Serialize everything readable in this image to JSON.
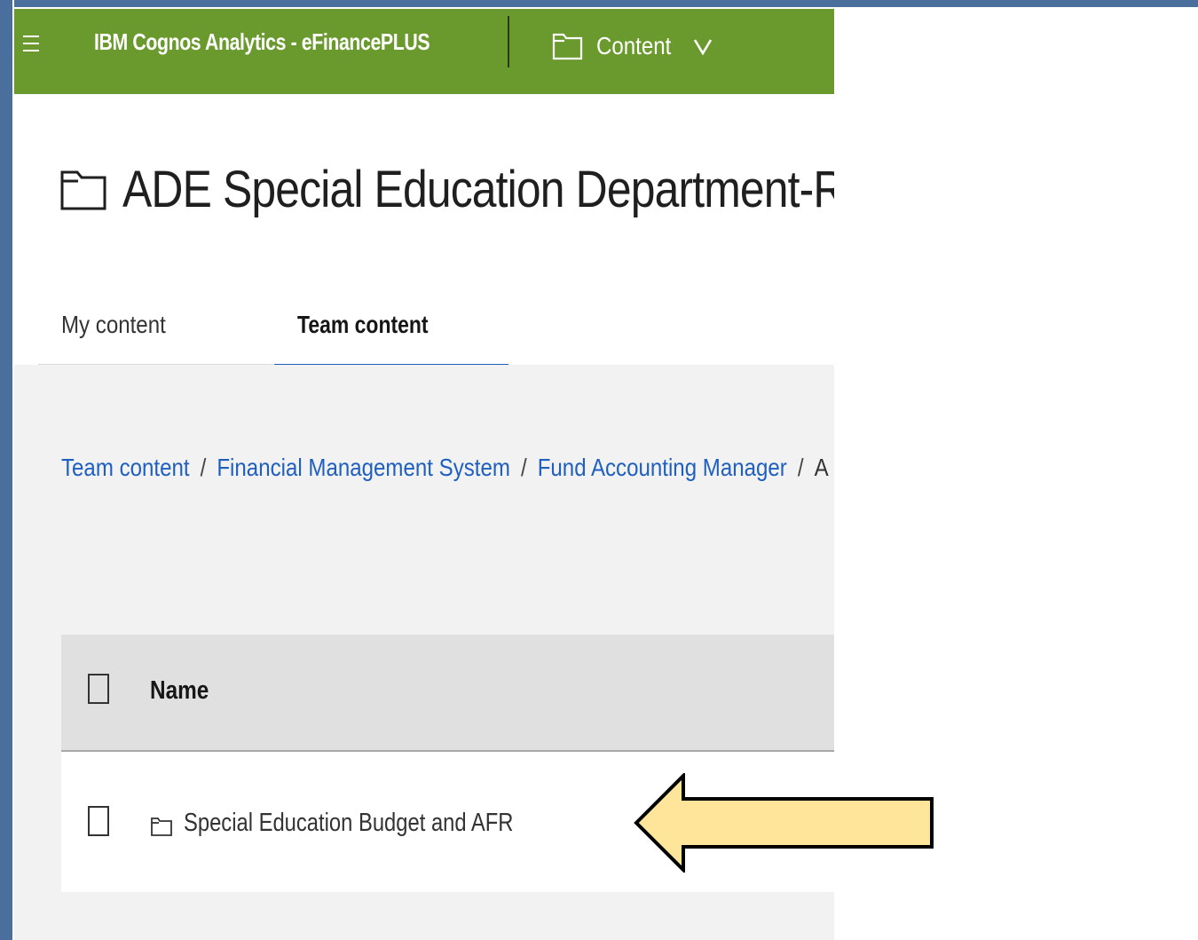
{
  "topbar": {
    "menu_icon": "hamburger-menu-icon",
    "title": "IBM Cognos Analytics - eFinancePLUS",
    "content_label": "Content",
    "content_icon": "folder-icon",
    "dropdown_icon": "chevron-down-icon",
    "background_color": "#6a9a2e"
  },
  "page": {
    "title": "ADE Special Education Department-Re",
    "title_icon": "folder-icon"
  },
  "tabs": [
    {
      "label": "My content",
      "active": false
    },
    {
      "label": "Team content",
      "active": true
    }
  ],
  "breadcrumb": {
    "items": [
      "Team content",
      "Financial Management System",
      "Fund Accounting Manager"
    ],
    "separator": "/",
    "truncated_tail": "A"
  },
  "table": {
    "header": {
      "name_label": "Name"
    },
    "rows": [
      {
        "name": "Special Education Budget and AFR",
        "icon": "folder-icon"
      }
    ]
  },
  "annotation": {
    "type": "arrow-left",
    "fill_color": "#ffe599",
    "stroke_color": "#000000"
  },
  "colors": {
    "link": "#1f5fbf",
    "active_tab_underline": "#1f5fbf",
    "frame": "#4a6f9c"
  }
}
